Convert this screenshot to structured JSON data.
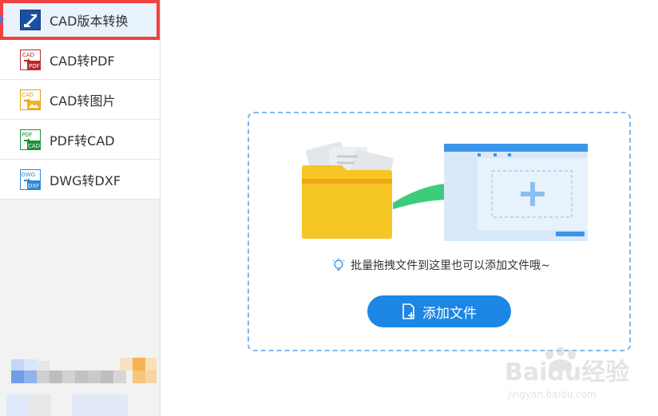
{
  "sidebar": {
    "items": [
      {
        "label": "CAD版本转换",
        "icon": "cad-version-convert-icon",
        "active": true
      },
      {
        "label": "CAD转PDF",
        "icon": "cad-to-pdf-icon",
        "active": false
      },
      {
        "label": "CAD转图片",
        "icon": "cad-to-image-icon",
        "active": false
      },
      {
        "label": "PDF转CAD",
        "icon": "pdf-to-cad-icon",
        "active": false
      },
      {
        "label": "DWG转DXF",
        "icon": "dwg-to-dxf-icon",
        "active": false
      }
    ]
  },
  "drop_zone": {
    "hint": "批量拖拽文件到这里也可以添加文件哦~",
    "add_button_label": "添加文件"
  },
  "icons": {
    "cad_badge": "CAD",
    "pdf_badge": "PDF",
    "dwg_badge": "DWG",
    "dxf_badge": "DXF"
  },
  "colors": {
    "accent_blue": "#1d86e4",
    "active_outline": "#ef4141",
    "folder_yellow": "#f6c624",
    "arrow_green": "#3dcc7b"
  },
  "watermark": {
    "brand": "Baidu经验",
    "url": "jingyan.baidu.com"
  }
}
